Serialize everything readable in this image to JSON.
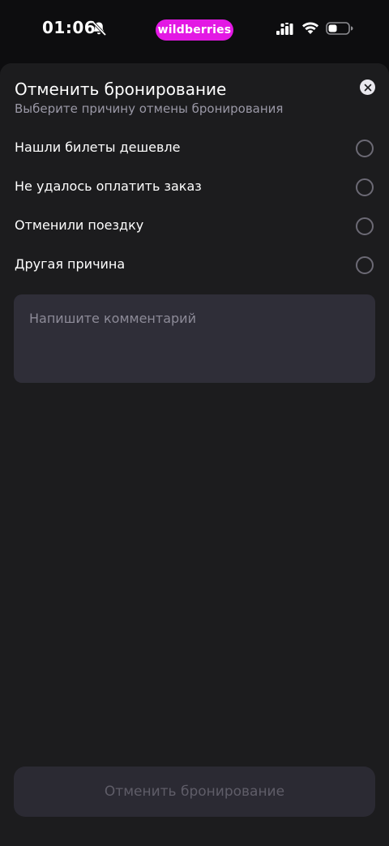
{
  "status_bar": {
    "time": "01:06",
    "brand": "wildberries",
    "icons": [
      "bell-off-icon",
      "signal-icon",
      "wifi-icon",
      "battery-icon"
    ]
  },
  "sheet": {
    "title": "Отменить бронирование",
    "subtitle": "Выберите причину отмены бронирования",
    "close_icon": "close-icon",
    "options": [
      {
        "label": "Нашли билеты дешевле",
        "selected": false
      },
      {
        "label": "Не удалось оплатить заказ",
        "selected": false
      },
      {
        "label": "Отменили поездку",
        "selected": false
      },
      {
        "label": "Другая причина",
        "selected": false
      }
    ],
    "comment": {
      "value": "",
      "placeholder": "Напишите комментарий"
    },
    "submit_label": "Отменить бронирование"
  },
  "colors": {
    "background": "#0d0d0f",
    "sheet": "#1c1c1e",
    "brand": "#e318e4",
    "input": "#2f2e38",
    "button_disabled": "#2b2a33",
    "button_text_disabled": "#5f5d68",
    "subtitle": "#9a98a6"
  }
}
